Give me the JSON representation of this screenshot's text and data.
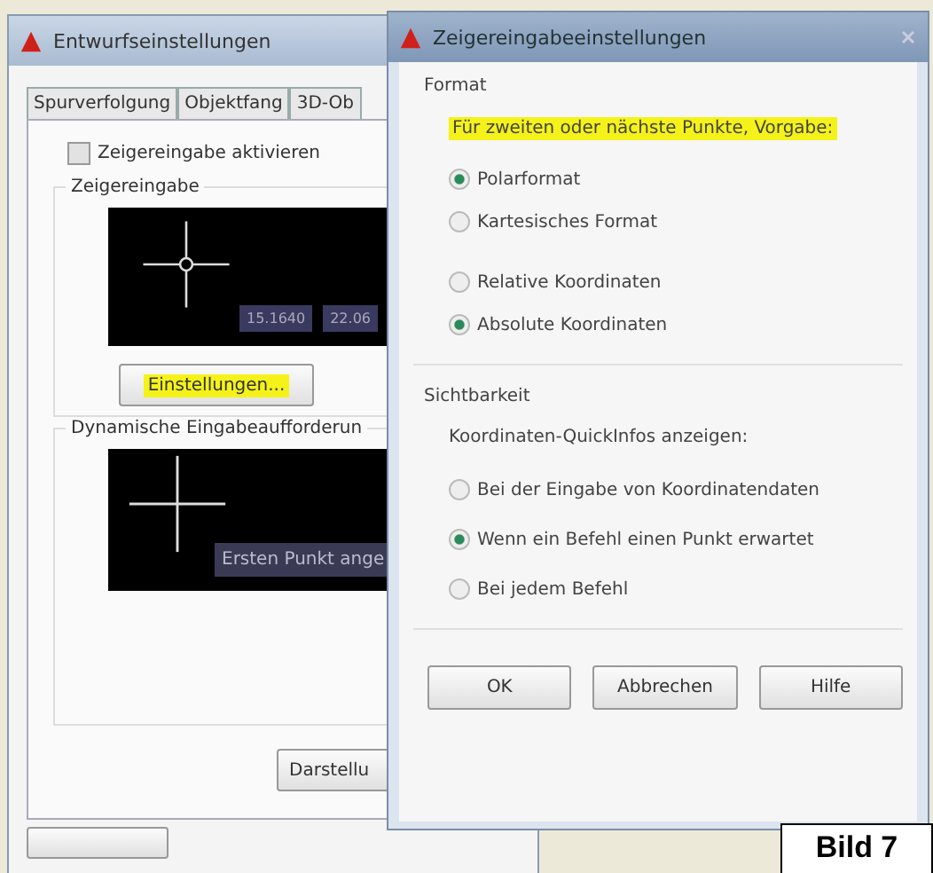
{
  "back_window": {
    "title": "Entwurfseinstellungen",
    "tabs": [
      {
        "label": "Spurverfolgung",
        "selected": false
      },
      {
        "label": "Objektfang",
        "selected": false
      },
      {
        "label": "3D-Ob",
        "selected": false
      }
    ],
    "enable_checkbox": {
      "label": "Zeigereingabe aktivieren",
      "checked": false
    },
    "pointer_group": {
      "title": "Zeigereingabe",
      "preview_values": [
        "15.1640",
        "22.06"
      ],
      "button": "Einstellungen...",
      "button_highlighted": true
    },
    "prompt_group": {
      "title": "Dynamische Eingabeaufforderun",
      "preview_tooltip": "Ersten Punkt ange"
    },
    "display_button": "Darstellu"
  },
  "front_window": {
    "title": "Zeigereingabeeinstellungen",
    "format": {
      "title": "Format",
      "prompt": "Für zweiten oder nächste Punkte, Vorgabe:",
      "prompt_highlighted": true,
      "format_options": [
        {
          "label": "Polarformat",
          "selected": true
        },
        {
          "label": "Kartesisches Format",
          "selected": false
        }
      ],
      "coordinate_options": [
        {
          "label": "Relative Koordinaten",
          "selected": false
        },
        {
          "label": "Absolute Koordinaten",
          "selected": true
        }
      ]
    },
    "visibility": {
      "title": "Sichtbarkeit",
      "prompt": "Koordinaten-QuickInfos anzeigen:",
      "options": [
        {
          "label": "Bei der Eingabe von Koordinatendaten",
          "selected": false
        },
        {
          "label": "Wenn ein Befehl einen Punkt erwartet",
          "selected": true
        },
        {
          "label": "Bei jedem Befehl",
          "selected": false
        }
      ]
    },
    "buttons": [
      "OK",
      "Abbrechen",
      "Hilfe"
    ]
  },
  "caption": "Bild 7"
}
